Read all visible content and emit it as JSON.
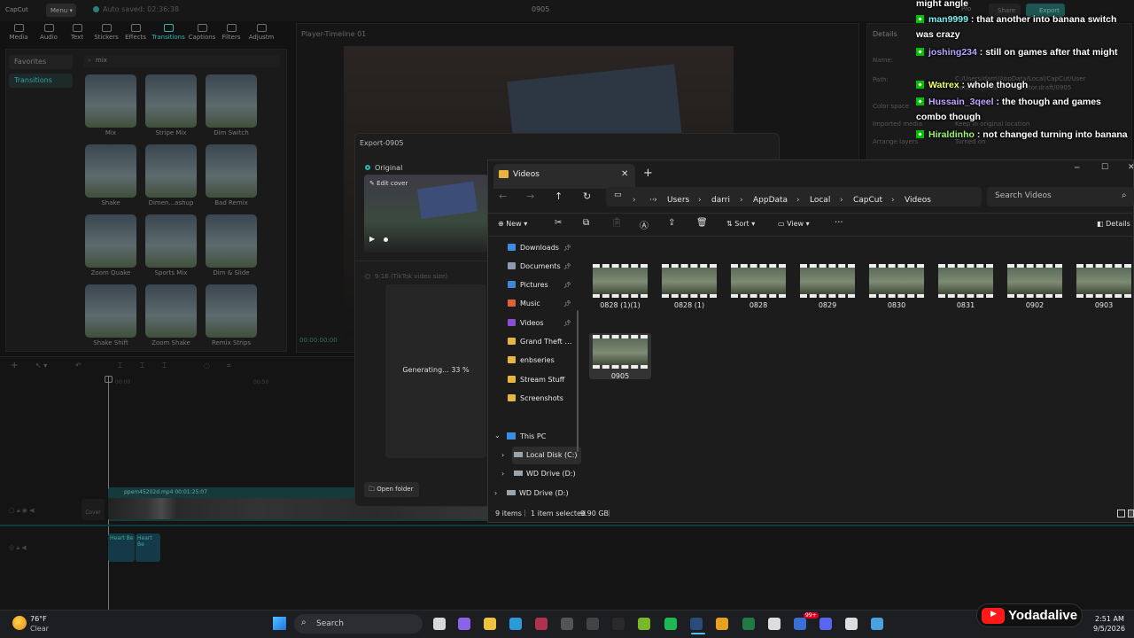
{
  "capcut": {
    "logo": "CapCut",
    "menu_label": "Menu",
    "autosave": "Auto saved: 02:36:38",
    "project_title": "0905",
    "pro_label": "Pro",
    "share_label": "Share",
    "export_label": "Export",
    "tools": [
      "Media",
      "Audio",
      "Text",
      "Stickers",
      "Effects",
      "Transitions",
      "Captions",
      "Filters",
      "Adjustm"
    ],
    "sidebar": [
      "Favorites",
      "Transitions"
    ],
    "search_value": "mix",
    "transitions": [
      "Mix",
      "Stripe Mix",
      "Dim Switch",
      "Shake",
      "Dimen...ashup",
      "Bad Remix",
      "Zoom Quake",
      "Sports Mix",
      "Dim & Slide",
      "Shake Shift",
      "Zoom Shake",
      "Remix Strips"
    ],
    "player_title": "Player-Timeline 01",
    "player_time": "00:00:00:00",
    "details": {
      "header": "Details",
      "rows": [
        "Name:",
        "Path:",
        "Color space",
        "Imported media",
        "Arrange layers"
      ],
      "path_value": "C:/Users/darri/AppData/Local/CapCut/User Data/Projects/com.lveditor.draft/0905",
      "imported_value": "Keep in original location",
      "arrange_value": "Turned on"
    },
    "timeline": {
      "ruler": [
        "00:00",
        "00:50"
      ],
      "clip_label": "ppem45202d.mp4  00:01:25:07",
      "cover_label": "Cover",
      "audio_clip": "Heart Be"
    }
  },
  "export_dialog": {
    "title": "Export-0905",
    "original_label": "Original",
    "edit_cover": "Edit cover",
    "size_option": "9:16 (TikTok video size)",
    "progress_text": "Generating... 33 %",
    "progress": 0.33,
    "open_folder": "Open folder"
  },
  "explorer": {
    "tab_title": "Videos",
    "breadcrumb": [
      "Users",
      "darri",
      "AppData",
      "Local",
      "CapCut",
      "Videos"
    ],
    "search_placeholder": "Search Videos",
    "toolbar": {
      "new": "New",
      "sort": "Sort",
      "view": "View",
      "more": "···",
      "details": "Details"
    },
    "nav_quick": [
      {
        "label": "Downloads",
        "color": "#3b8de0",
        "pinned": true
      },
      {
        "label": "Documents",
        "color": "#8a9bb0",
        "pinned": true
      },
      {
        "label": "Pictures",
        "color": "#3f87d8",
        "pinned": true
      },
      {
        "label": "Music",
        "color": "#e0603a",
        "pinned": true
      },
      {
        "label": "Videos",
        "color": "#8a4fd0",
        "pinned": true
      },
      {
        "label": "Grand Theft Aut",
        "color": "#e8b640",
        "pinned": false
      },
      {
        "label": "enbseries",
        "color": "#e8b640",
        "pinned": false
      },
      {
        "label": "Stream Stuff",
        "color": "#e8b640",
        "pinned": false
      },
      {
        "label": "Screenshots",
        "color": "#e8b640",
        "pinned": false
      }
    ],
    "nav_pc": {
      "this_pc": "This PC",
      "drives": [
        "Local Disk (C:)",
        "WD Drive (D:)",
        "WD Drive (D:)"
      ]
    },
    "files": [
      "0828 (1)(1)",
      "0828 (1)",
      "0828",
      "0829",
      "0830",
      "0831",
      "0902",
      "0903",
      "0905"
    ],
    "status": {
      "items": "9 items",
      "selected": "1 item selected",
      "size": "9.90 GB"
    }
  },
  "chat": [
    {
      "user": "",
      "color": "#ffffff",
      "message": "might angle"
    },
    {
      "user": "man9999",
      "color": "#7ff0f0",
      "message": ": that another into banana switch was crazy"
    },
    {
      "user": "joshing234",
      "color": "#b9a5ff",
      "message": ": still on games after that might"
    },
    {
      "user": "Watrex",
      "color": "#f2ff6a",
      "message": ": whole though"
    },
    {
      "user": "Hussain_3qeel",
      "color": "#c7a4ff",
      "message": ": the though and games combo though"
    },
    {
      "user": "Hiraldinho",
      "color": "#9ff26a",
      "message": ": not changed turning into banana"
    }
  ],
  "taskbar": {
    "temperature": "76°F",
    "weather": "Clear",
    "search": "Search",
    "time": "2:51 AM",
    "date": "9/5/2026",
    "streamer": "Yodadalive",
    "badge": "99+"
  }
}
